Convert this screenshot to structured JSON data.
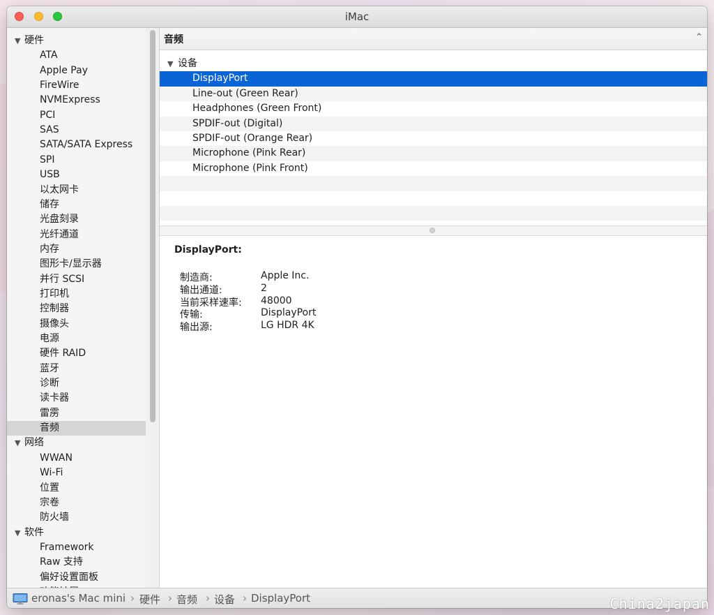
{
  "window": {
    "title": "iMac"
  },
  "sidebar": {
    "items": [
      {
        "type": "group",
        "label": "硬件"
      },
      {
        "type": "item",
        "label": "ATA"
      },
      {
        "type": "item",
        "label": "Apple Pay"
      },
      {
        "type": "item",
        "label": "FireWire"
      },
      {
        "type": "item",
        "label": "NVMExpress"
      },
      {
        "type": "item",
        "label": "PCI"
      },
      {
        "type": "item",
        "label": "SAS"
      },
      {
        "type": "item",
        "label": "SATA/SATA Express"
      },
      {
        "type": "item",
        "label": "SPI"
      },
      {
        "type": "item",
        "label": "USB"
      },
      {
        "type": "item",
        "label": "以太网卡"
      },
      {
        "type": "item",
        "label": "储存"
      },
      {
        "type": "item",
        "label": "光盘刻录"
      },
      {
        "type": "item",
        "label": "光纤通道"
      },
      {
        "type": "item",
        "label": "内存"
      },
      {
        "type": "item",
        "label": "图形卡/显示器"
      },
      {
        "type": "item",
        "label": "并行 SCSI"
      },
      {
        "type": "item",
        "label": "打印机"
      },
      {
        "type": "item",
        "label": "控制器"
      },
      {
        "type": "item",
        "label": "摄像头"
      },
      {
        "type": "item",
        "label": "电源"
      },
      {
        "type": "item",
        "label": "硬件 RAID"
      },
      {
        "type": "item",
        "label": "蓝牙"
      },
      {
        "type": "item",
        "label": "诊断"
      },
      {
        "type": "item",
        "label": "读卡器"
      },
      {
        "type": "item",
        "label": "雷雳"
      },
      {
        "type": "item",
        "label": "音频",
        "selected": true
      },
      {
        "type": "group",
        "label": "网络"
      },
      {
        "type": "item",
        "label": "WWAN"
      },
      {
        "type": "item",
        "label": "Wi-Fi"
      },
      {
        "type": "item",
        "label": "位置"
      },
      {
        "type": "item",
        "label": "宗卷"
      },
      {
        "type": "item",
        "label": "防火墙"
      },
      {
        "type": "group",
        "label": "软件"
      },
      {
        "type": "item",
        "label": "Framework"
      },
      {
        "type": "item",
        "label": "Raw 支持"
      },
      {
        "type": "item",
        "label": "偏好设置面板"
      },
      {
        "type": "item",
        "label": "功能扩展"
      }
    ]
  },
  "content": {
    "section_title": "音频",
    "group_label": "设备",
    "devices": [
      {
        "label": "DisplayPort",
        "selected": true
      },
      {
        "label": "Line-out (Green Rear)"
      },
      {
        "label": "Headphones (Green Front)"
      },
      {
        "label": "SPDIF-out (Digital)"
      },
      {
        "label": "SPDIF-out (Orange Rear)"
      },
      {
        "label": "Microphone (Pink Rear)"
      },
      {
        "label": "Microphone (Pink Front)"
      }
    ],
    "detail": {
      "title": "DisplayPort:",
      "properties": [
        {
          "key": "制造商:",
          "value": "Apple Inc."
        },
        {
          "key": "输出通道:",
          "value": "2"
        },
        {
          "key": "当前采样速率:",
          "value": "48000"
        },
        {
          "key": "传输:",
          "value": "DisplayPort"
        },
        {
          "key": "输出源:",
          "value": "LG HDR 4K"
        }
      ]
    }
  },
  "statusbar": {
    "icon": "imac-icon",
    "crumbs": [
      "eronas's Mac mini",
      "硬件",
      "音频",
      "设备",
      "DisplayPort"
    ],
    "separator": "›"
  },
  "watermark": "China2japan",
  "colors": {
    "selection": "#0b64d6",
    "sidebar_selection": "#d5d5d5"
  }
}
